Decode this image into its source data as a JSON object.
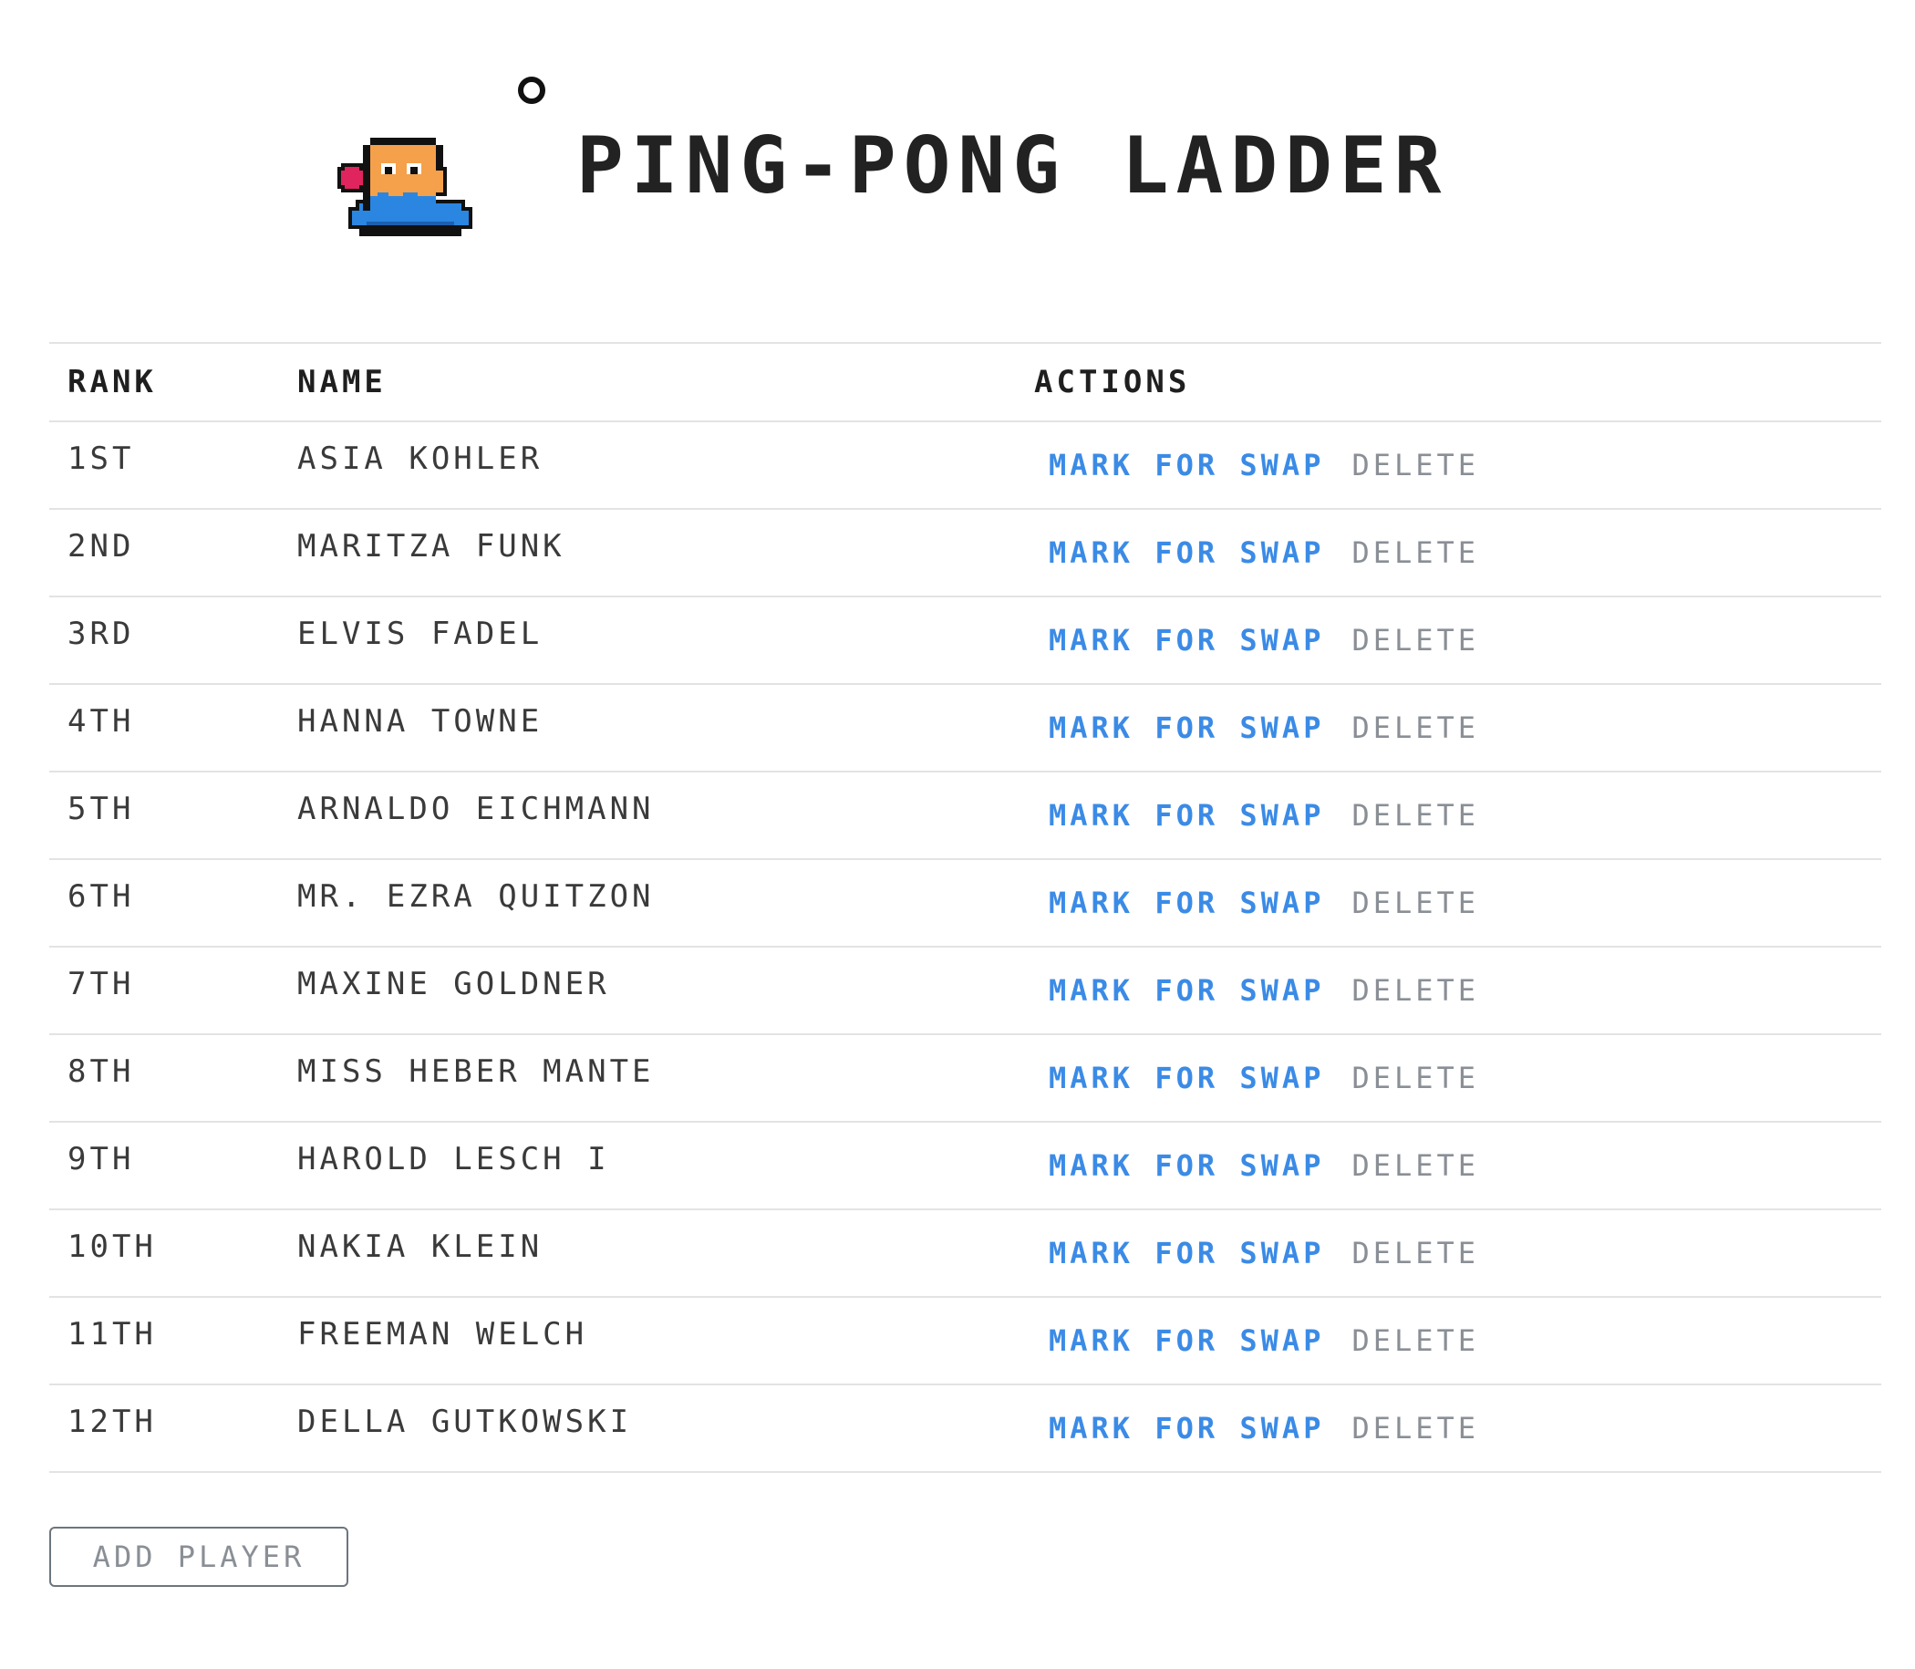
{
  "header": {
    "title": "PING-PONG LADDER",
    "mascot_icon": "pixel-mascot-with-paddle-icon",
    "ball_icon": "ping-pong-ball-icon"
  },
  "table": {
    "columns": {
      "rank": "RANK",
      "name": "NAME",
      "actions": "ACTIONS"
    },
    "action_labels": {
      "swap": "MARK FOR SWAP",
      "delete": "DELETE"
    },
    "rows": [
      {
        "rank": "1ST",
        "name": "ASIA KOHLER"
      },
      {
        "rank": "2ND",
        "name": "MARITZA FUNK"
      },
      {
        "rank": "3RD",
        "name": "ELVIS FADEL"
      },
      {
        "rank": "4TH",
        "name": "HANNA TOWNE"
      },
      {
        "rank": "5TH",
        "name": "ARNALDO EICHMANN"
      },
      {
        "rank": "6TH",
        "name": "MR. EZRA QUITZON"
      },
      {
        "rank": "7TH",
        "name": "MAXINE GOLDNER"
      },
      {
        "rank": "8TH",
        "name": "MISS HEBER MANTE"
      },
      {
        "rank": "9TH",
        "name": "HAROLD LESCH I"
      },
      {
        "rank": "10TH",
        "name": "NAKIA KLEIN"
      },
      {
        "rank": "11TH",
        "name": "FREEMAN WELCH"
      },
      {
        "rank": "12TH",
        "name": "DELLA GUTKOWSKI"
      }
    ]
  },
  "add_player": {
    "label": "ADD PLAYER"
  },
  "colors": {
    "swap_link": "#3b8be6",
    "delete_link": "#8a8f96",
    "mascot_orange": "#f5a04a",
    "mascot_blue": "#2a86e0",
    "paddle_red": "#e0245e"
  }
}
